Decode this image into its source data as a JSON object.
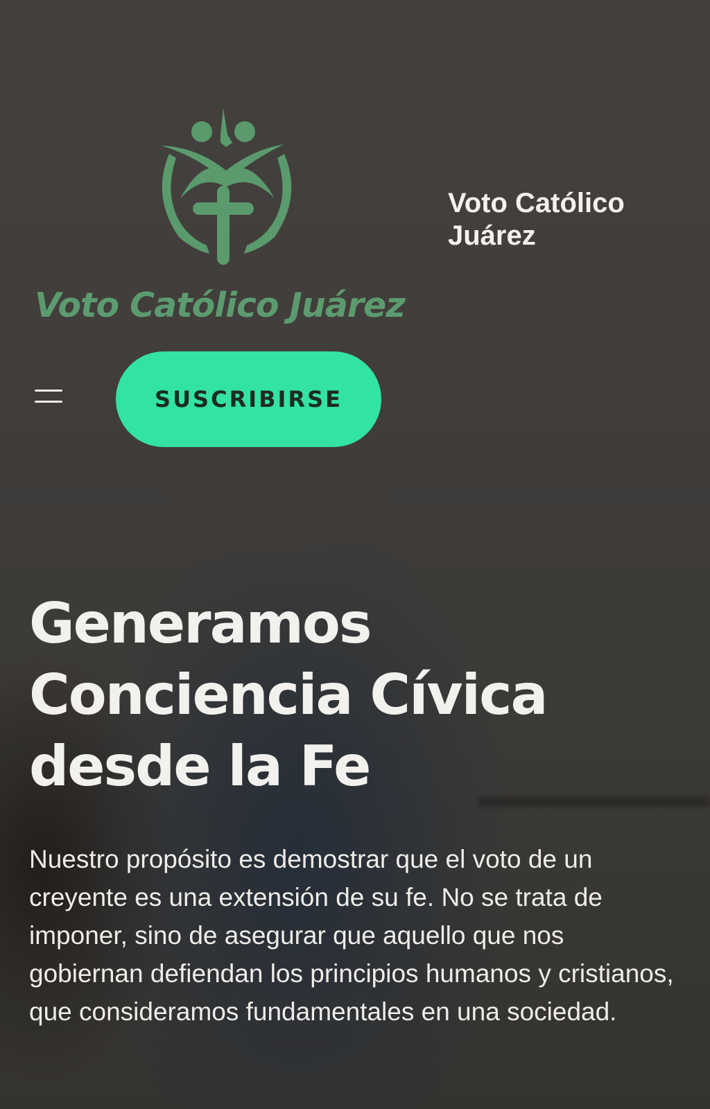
{
  "logo": {
    "text": "Voto Católico Juárez",
    "color": "#5c9b6f"
  },
  "header": {
    "site_title": "Voto Católico Juárez"
  },
  "nav": {
    "menu_icon": "hamburger-menu-icon",
    "subscribe_label": "SUSCRIBIRSE",
    "subscribe_color": "#32e3a3"
  },
  "hero": {
    "title": "Generamos Conciencia Cívica desde la Fe",
    "description": "Nuestro propósito es demostrar que el voto de un creyente es una extensión de su fe. No se trata de imponer, sino de asegurar que aquello que nos gobiernan defiendan los principios humanos y cristianos, que consideramos fundamentales en una sociedad."
  }
}
